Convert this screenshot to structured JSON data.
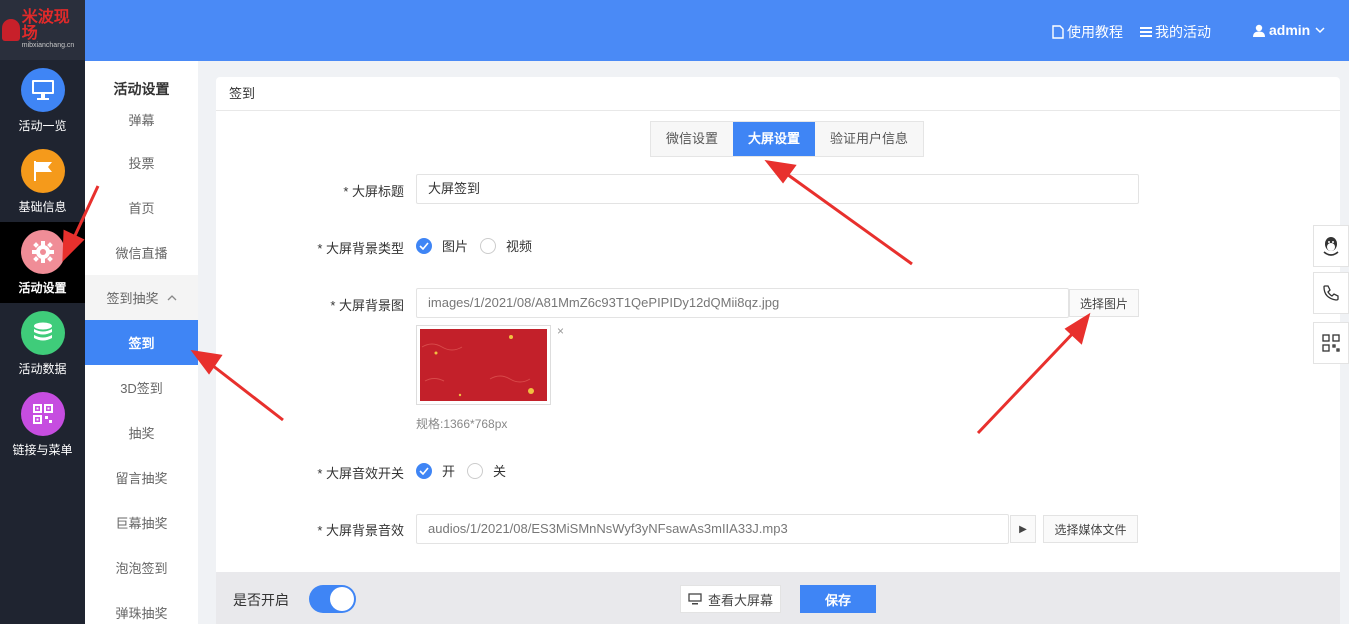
{
  "logo": {
    "text": "米波现场",
    "sub": "mibxianchang.cn"
  },
  "iconnav": [
    {
      "label": "活动一览",
      "color": "#3f85f5",
      "icon": "monitor-icon"
    },
    {
      "label": "基础信息",
      "color": "#f59a1b",
      "icon": "flag-icon"
    },
    {
      "label": "活动设置",
      "color": "#f08d97",
      "icon": "gear-icon"
    },
    {
      "label": "活动数据",
      "color": "#3fcc7a",
      "icon": "database-icon"
    },
    {
      "label": "链接与菜单",
      "color": "#c64de0",
      "icon": "qrcode-icon"
    }
  ],
  "subnav": {
    "title": "活动设置",
    "items": [
      "弹幕",
      "投票",
      "首页",
      "微信直播",
      "签到抽奖",
      "签到",
      "3D签到",
      "抽奖",
      "留言抽奖",
      "巨幕抽奖",
      "泡泡签到",
      "弹珠抽奖"
    ]
  },
  "header": {
    "tutorial": "使用教程",
    "my_activities": "我的活动",
    "user": "admin"
  },
  "card": {
    "title": "签到"
  },
  "tabs": [
    "微信设置",
    "大屏设置",
    "验证用户信息"
  ],
  "form": {
    "title_label": "* 大屏标题",
    "title_value": "大屏签到",
    "bg_type_label": "* 大屏背景类型",
    "bg_type_options": [
      "图片",
      "视频"
    ],
    "bg_image_label": "* 大屏背景图",
    "bg_image_value": "images/1/2021/08/A81MmZ6c93T1QePIPIDy12dQMii8qz.jpg",
    "select_image": "选择图片",
    "thumb_close": "×",
    "spec": "规格:1366*768px",
    "sound_switch_label": "* 大屏音效开关",
    "sound_options": [
      "开",
      "关"
    ],
    "bg_sound_label": "* 大屏背景音效",
    "bg_sound_value": "audios/1/2021/08/ES3MiSMnNsWyf3yNFsawAs3mIIA33J.mp3",
    "play": "▶",
    "select_media": "选择媒体文件"
  },
  "bottom": {
    "enable_label": "是否开启",
    "view_screen": "查看大屏幕",
    "save": "保存"
  },
  "colors": {
    "primary": "#3f85f5",
    "header": "#4a8af6",
    "arrow": "#e8302d"
  }
}
